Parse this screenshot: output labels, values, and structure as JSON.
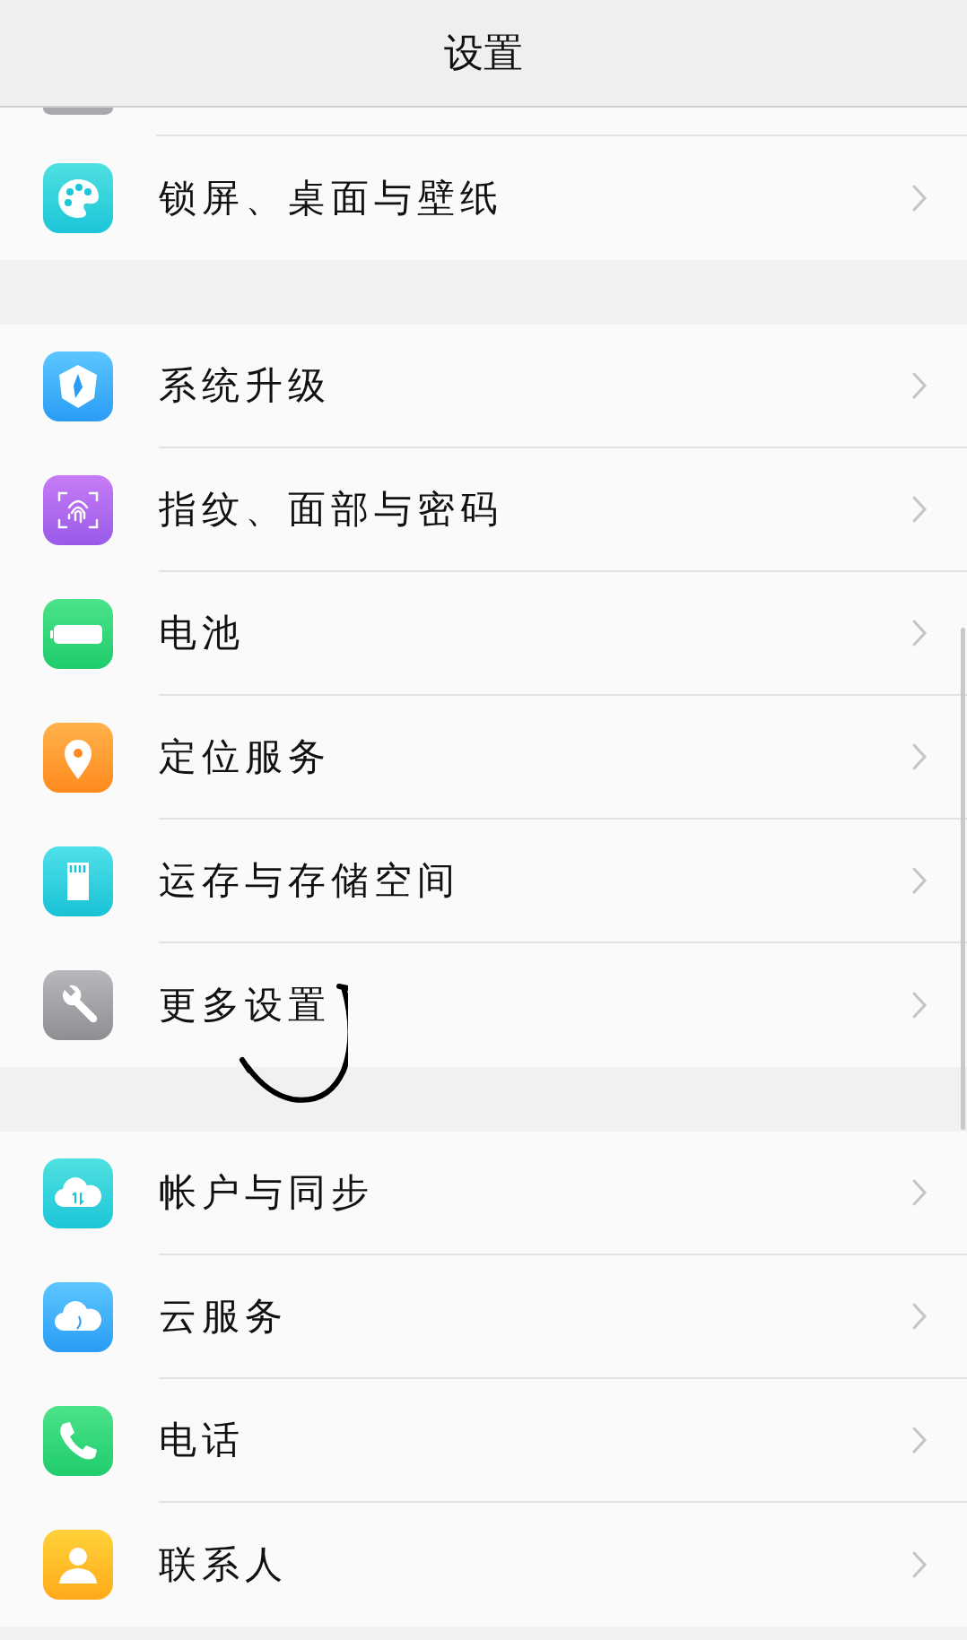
{
  "title": "设置",
  "groups": [
    {
      "items": [
        {
          "label": "锁屏、桌面与壁纸",
          "kind": "palette"
        }
      ]
    },
    {
      "items": [
        {
          "label": "系统升级",
          "kind": "upgrade"
        },
        {
          "label": "指纹、面部与密码",
          "kind": "fingerprint"
        },
        {
          "label": "电池",
          "kind": "battery"
        },
        {
          "label": "定位服务",
          "kind": "location"
        },
        {
          "label": "运存与存储空间",
          "kind": "storage"
        },
        {
          "label": "更多设置",
          "kind": "wrench"
        }
      ]
    },
    {
      "items": [
        {
          "label": "帐户与同步",
          "kind": "sync"
        },
        {
          "label": "云服务",
          "kind": "cloud"
        },
        {
          "label": "电话",
          "kind": "phone"
        },
        {
          "label": "联系人",
          "kind": "contact"
        }
      ]
    }
  ]
}
